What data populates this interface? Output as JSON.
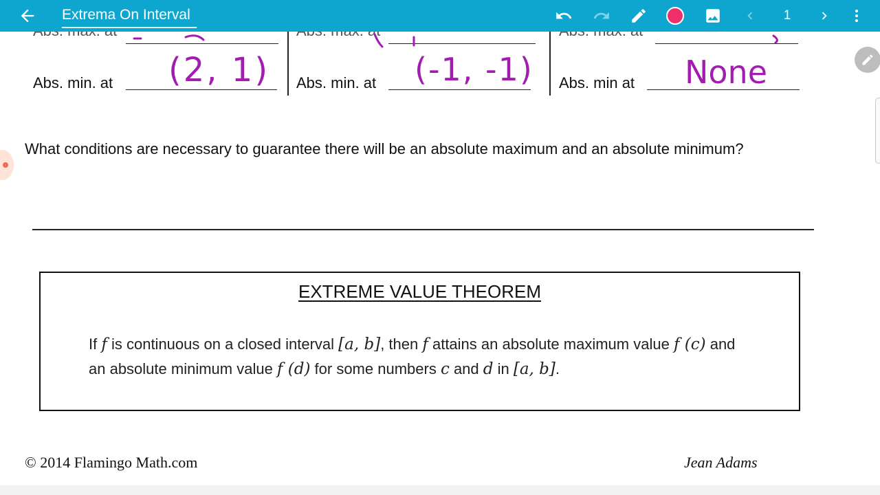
{
  "appbar": {
    "title": "Extrema On Interval",
    "page_number": "1",
    "colors": {
      "bar": "#0ea5cf",
      "pen_color": "#ef2f6b"
    }
  },
  "worksheet": {
    "columns": [
      {
        "max_label": "Abs. max. at",
        "min_label": "Abs. min. at",
        "min_answer": "(2, 1)"
      },
      {
        "max_label": "Abs. max. at",
        "min_label": "Abs. min. at",
        "min_answer": "(-1, -1)"
      },
      {
        "max_label": "Abs. max. at",
        "min_label": "Abs. min at",
        "min_answer": "None"
      }
    ],
    "question": "What conditions are necessary to guarantee there will be an absolute maximum and an absolute minimum?",
    "theorem": {
      "title": "EXTREME VALUE THEOREM",
      "t1": "If ",
      "f1": "f",
      "t2": " is continuous on a closed interval ",
      "ab1": "[a, b]",
      "t3": ", then ",
      "f2": "f",
      "t4": " attains an absolute maximum value ",
      "fc": "f (c)",
      "t5": " and an absolute minimum value ",
      "fd": "f (d)",
      "t6": " for some numbers ",
      "c": "c",
      "t7": " and ",
      "d": "d",
      "t8": " in ",
      "ab2": "[a, b]",
      "t9": "."
    },
    "footer": {
      "copyright": "© 2014 Flamingo Math.com",
      "author": "Jean Adams"
    },
    "ink_color": "#a21caf"
  }
}
